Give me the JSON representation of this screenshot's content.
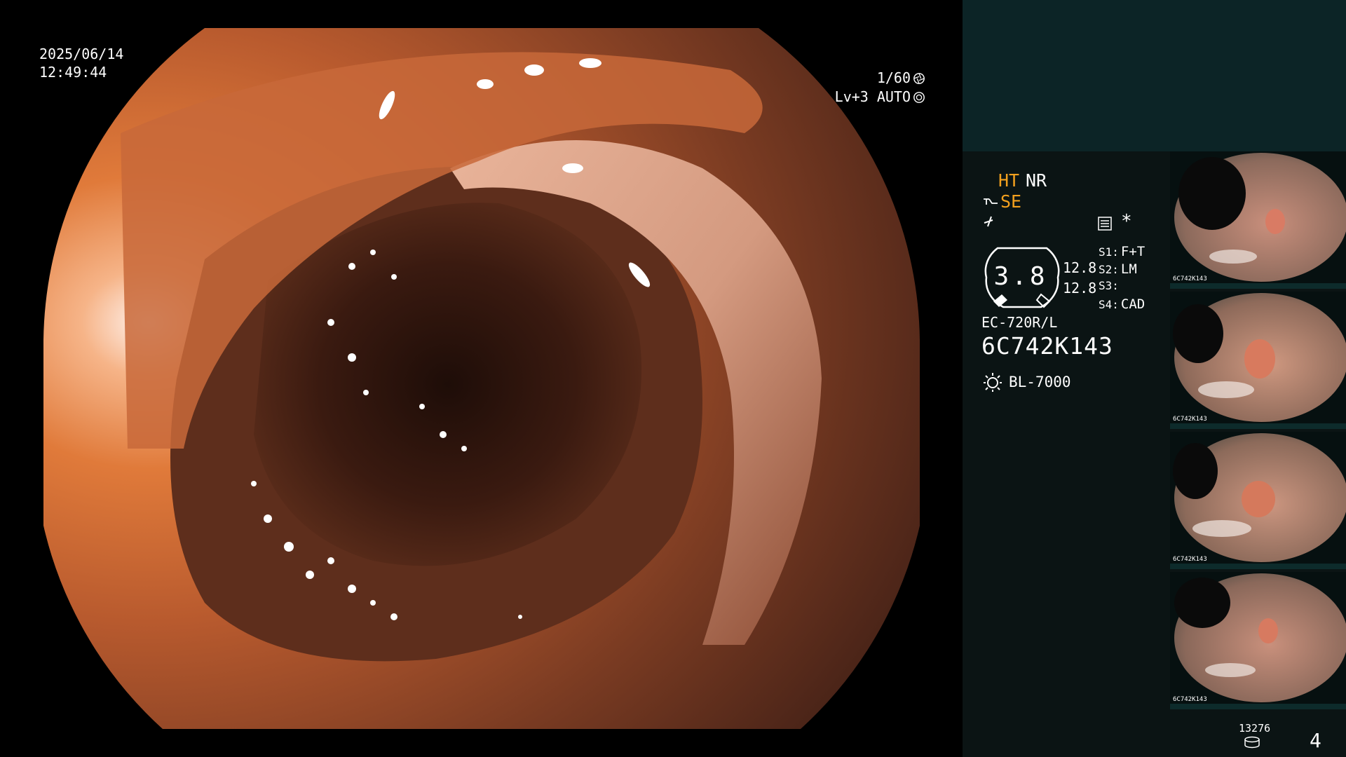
{
  "overlay": {
    "date": "2025/06/14",
    "time": "12:49:44",
    "shutter": "1/60",
    "level": "Lv+3",
    "iris_mode": "AUTO"
  },
  "panel": {
    "mode_ht": "HT",
    "mode_nr": "NR",
    "mode_se": "SE",
    "asterisk": "*",
    "zoom_value": "3.8",
    "scale_1": "12.8",
    "scale_2": "12.8",
    "switches": [
      {
        "key": "S1:",
        "value": "F+T"
      },
      {
        "key": "S2:",
        "value": "LM"
      },
      {
        "key": "S3:",
        "value": ""
      },
      {
        "key": "S4:",
        "value": "CAD"
      }
    ],
    "scope_model": "EC-720R/L",
    "scope_serial": "6C742K143",
    "light_source": "BL-7000",
    "colors": {
      "accent": "#f2a01e",
      "panel_top": "#0c2426",
      "panel_bg": "#0b1414"
    }
  },
  "footer": {
    "image_count": "13276",
    "page_number": "4"
  },
  "thumbnails": [
    {
      "label": "6C742K143"
    },
    {
      "label": "6C742K143"
    },
    {
      "label": "6C742K143"
    },
    {
      "label": "6C742K143"
    }
  ]
}
